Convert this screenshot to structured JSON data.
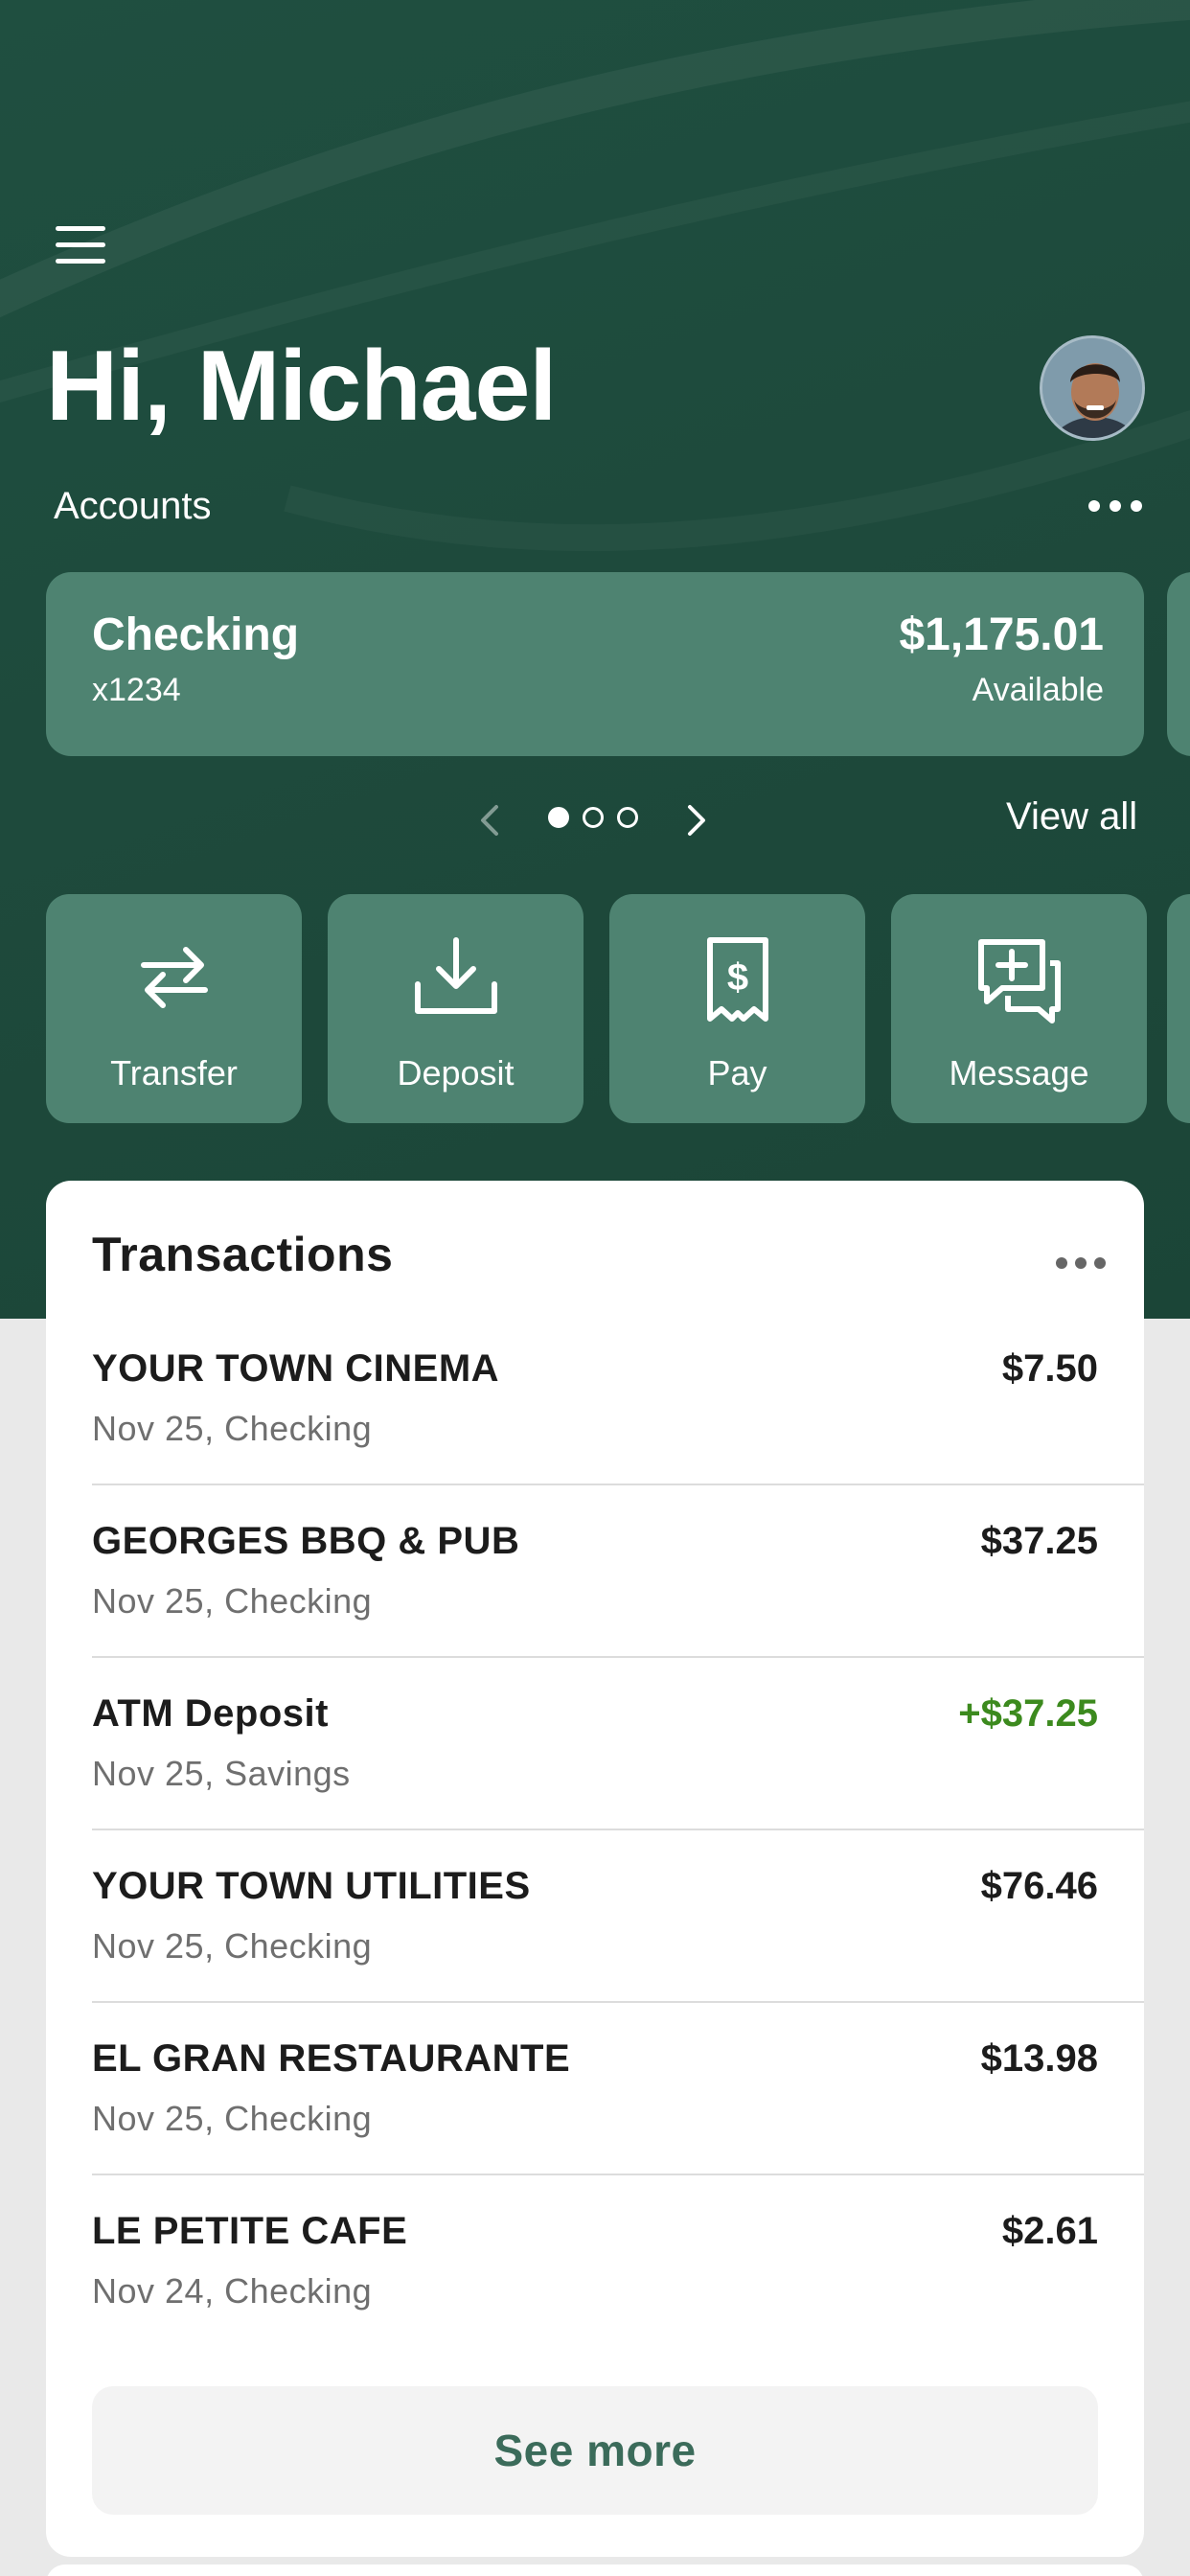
{
  "header": {
    "greeting": "Hi, Michael",
    "accounts_label": "Accounts"
  },
  "account_card": {
    "name": "Checking",
    "number": "x1234",
    "balance": "$1,175.01",
    "balance_label": "Available"
  },
  "pager": {
    "pages": 3,
    "active_index": 0,
    "view_all_label": "View all"
  },
  "actions": [
    {
      "label": "Transfer",
      "icon": "transfer-arrows-icon"
    },
    {
      "label": "Deposit",
      "icon": "download-tray-icon"
    },
    {
      "label": "Pay",
      "icon": "receipt-dollar-icon"
    },
    {
      "label": "Message",
      "icon": "chat-plus-icon"
    }
  ],
  "transactions": {
    "title": "Transactions",
    "items": [
      {
        "merchant": "YOUR TOWN CINEMA",
        "meta": "Nov 25, Checking",
        "amount": "$7.50",
        "credit": false
      },
      {
        "merchant": "GEORGES BBQ & PUB",
        "meta": "Nov 25, Checking",
        "amount": "$37.25",
        "credit": false
      },
      {
        "merchant": "ATM Deposit",
        "meta": "Nov 25, Savings",
        "amount": "+$37.25",
        "credit": true
      },
      {
        "merchant": "YOUR TOWN UTILITIES",
        "meta": "Nov 25, Checking",
        "amount": "$76.46",
        "credit": false
      },
      {
        "merchant": "EL GRAN RESTAURANTE",
        "meta": "Nov 25, Checking",
        "amount": "$13.98",
        "credit": false
      },
      {
        "merchant": "LE PETITE CAFE",
        "meta": "Nov 24, Checking",
        "amount": "$2.61",
        "credit": false
      }
    ],
    "see_more_label": "See more"
  },
  "colors": {
    "header_bg": "#1e4a3c",
    "card_bg": "#4e8371",
    "credit_green": "#3c8a1e",
    "see_more_text": "#3b6b5a"
  }
}
